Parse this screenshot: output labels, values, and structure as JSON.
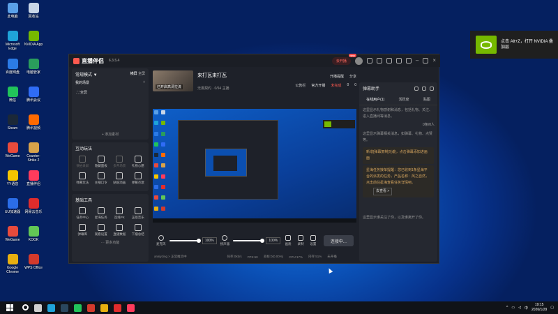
{
  "desktop": {
    "icons": [
      {
        "label": "此电脑",
        "color": "#5aa0e8"
      },
      {
        "label": "回收站",
        "color": "#c9d6e8"
      },
      {
        "label": "Microsoft Edge",
        "color": "#1fa3d9"
      },
      {
        "label": "NVIDIA App",
        "color": "#76b900"
      },
      {
        "label": "百度网盘",
        "color": "#2b7be6"
      },
      {
        "label": "电脑管家",
        "color": "#2a9d5c"
      },
      {
        "label": "微信",
        "color": "#21c35a"
      },
      {
        "label": "腾讯会议",
        "color": "#2f6cf6"
      },
      {
        "label": "Steam",
        "color": "#1b2838"
      },
      {
        "label": "腾讯视频",
        "color": "#ff6a00"
      },
      {
        "label": "WeGame",
        "color": "#e84b3c"
      },
      {
        "label": "Counter-Strike 2",
        "color": "#d8a24a"
      },
      {
        "label": "YY语音",
        "color": "#f5c500"
      },
      {
        "label": "直播伴侣",
        "color": "#ff3b5c"
      },
      {
        "label": "UU加速器",
        "color": "#2b6de8"
      },
      {
        "label": "网易云音乐",
        "color": "#e02c2c"
      },
      {
        "label": "WeGame",
        "color": "#e84b3c"
      },
      {
        "label": "KOOK",
        "color": "#62c755"
      },
      {
        "label": "Google Chrome",
        "color": "#e8b010"
      },
      {
        "label": "WPS Office",
        "color": "#d33a2c"
      }
    ]
  },
  "nvidia_notification": {
    "text": "点击 Alt+Z，打开 NVIDIA 叠加层"
  },
  "app": {
    "title": "直播伴侣",
    "version": "6.3.5.4",
    "live_pill": "去开播",
    "new_badge": "new",
    "left": {
      "mode_label": "常规模式 ▼",
      "mode_opts": [
        "横屏",
        "全屏"
      ],
      "scene_label": "我的场景",
      "scene_tabs": [
        "直播",
        "视频",
        "添加"
      ],
      "scene_item": "全屏",
      "add_material": "+ 添加素材",
      "interact_title": "互动玩法",
      "interact_tools": [
        {
          "label": "快拍录屏",
          "dim": true
        },
        {
          "label": "隐藏面板",
          "dim": false
        },
        {
          "label": "多开场景",
          "dim": true
        },
        {
          "label": "礼物心愿",
          "dim": false
        },
        {
          "label": "弹幕玩法",
          "dim": false
        },
        {
          "label": "主播口令",
          "dim": false
        },
        {
          "label": "贴纸动画",
          "dim": false
        },
        {
          "label": "弹幕点歌",
          "dim": false
        }
      ],
      "tools_title": "基础工具",
      "basic_tools": [
        {
          "label": "任务中心"
        },
        {
          "label": "星海任务"
        },
        {
          "label": "连线PK"
        },
        {
          "label": "正版音乐"
        },
        {
          "label": "弹幕库"
        },
        {
          "label": "观看设置"
        },
        {
          "label": "直播数据"
        },
        {
          "label": "下播总结"
        }
      ],
      "more": "··· 更多功能"
    },
    "center": {
      "thumb_label": "已开启高清拉流",
      "stream_title": "来打瓦来打瓦",
      "stream_sub": "无畏契约 · 0/94 主播",
      "actions_top": [
        "开播提醒",
        "分享"
      ],
      "actions_bottom": [
        "公告栏",
        "官方开播",
        "未完成",
        "0",
        "0"
      ],
      "mic_label": "麦克风",
      "mic_pct": "100%",
      "spk_label": "扬声器",
      "spk_pct": "100%",
      "tool_buttons": [
        "画质",
        "录制",
        "设置"
      ],
      "connect_btn": "连接中...",
      "status_items": [
        "analyzing > 正常推流中",
        "码率:0kb/s",
        "FPS:60",
        "丢帧:0(0.00%)",
        "CPU:17%",
        "内存:51%",
        "未开播"
      ]
    },
    "right": {
      "title": "弹幕助手",
      "tabs": [
        "在线用户(1)",
        "活跃度",
        "贴图"
      ],
      "msg1": "这里显示礼物感谢和消息，包括礼物、关注、进入直播间等消息。",
      "sub_label": "0条/0人",
      "msg2": "这里显示弹幕相关消息，如弹幕、礼物、点赞等。",
      "hl1": "新增[弹幕复制]功能，点击弹幕添加进画面",
      "hl2": "星海任务接单提醒：您已收到1条星海平台的派发的任务，产品名称：风之自然，点击前往星海查看任务详情吧。",
      "more_btn": "去查看 >",
      "msg3": "这里显示谁关注了你，以及谁离开了你。"
    }
  },
  "taskbar": {
    "apps": [
      {
        "name": "search-icon",
        "color": "#ffffff"
      },
      {
        "name": "taskview-icon",
        "color": "#cfcfcf"
      },
      {
        "name": "edge-icon",
        "color": "#1fa3d9"
      },
      {
        "name": "steam-icon",
        "color": "#2a475e"
      },
      {
        "name": "wechat-icon",
        "color": "#21c35a"
      },
      {
        "name": "wps-icon",
        "color": "#d33a2c"
      },
      {
        "name": "chrome-icon",
        "color": "#e8b010"
      },
      {
        "name": "netease-icon",
        "color": "#e02c2c"
      },
      {
        "name": "douyin-icon",
        "color": "#ff3b5c"
      }
    ],
    "ime": "中",
    "time": "19:15",
    "date": "2026/1/29"
  }
}
